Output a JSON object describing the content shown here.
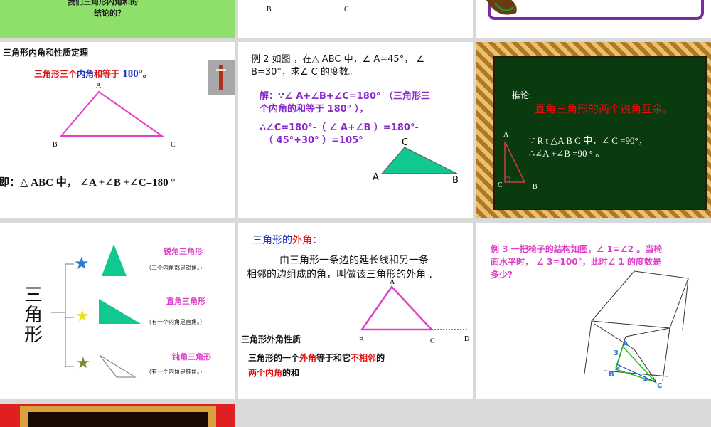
{
  "colors": {
    "gray_bg": "#d9d9d9",
    "green_slide": "#8fe06a",
    "magenta": "#e040c8",
    "red": "#e01010",
    "blue": "#2030c0",
    "purple": "#8a28d0",
    "teal": "#10c890",
    "blackboard": "#0a3a10",
    "frame_gold": "#d9a040"
  },
  "slides": {
    "s1": {
      "lines": [
        "我们三角形内角和的",
        "结论的？"
      ]
    },
    "s2": {
      "labels": {
        "b": "B",
        "c": "C"
      }
    },
    "s4": {
      "title": "三角形内角和性质定理",
      "theorem_red": "三角形三个",
      "theorem_blue": "内角",
      "theorem_red2": "和等于",
      "theorem_value": "180°",
      "theorem_end": "。",
      "labels": {
        "a": "A",
        "b": "B",
        "c": "C"
      },
      "statement": "即：△ ABC 中， ∠A +∠B +∠C=180 °",
      "thumb_icon": "book-image-icon"
    },
    "s5": {
      "problem_1": "例 2  如图 ，在△ ABC 中，∠ A=45°，  ∠",
      "problem_2": "B=30°，求∠ C 的度数。",
      "sol_1": "解：∵∠ A+∠B+∠C=180° （三角形三",
      "sol_2": "个内角的和等于 180° ），",
      "sol_3": "∴∠C=180°-（  ∠ A+∠B ）=180°-",
      "sol_4": "（ 45°+30° ）=105°",
      "labels": {
        "a": "A",
        "b": "B",
        "c": "C"
      }
    },
    "s6": {
      "heading": "推论:",
      "corollary": "直角三角形的两个锐角互余。",
      "given": "∵ R t △A B C  中，∠ C =90°，",
      "result": "∴∠A +∠B =90 ° 。",
      "labels": {
        "a": "A",
        "b": "B",
        "c": "C"
      }
    },
    "s7": {
      "root_label": "三角形",
      "acute_label": "锐角三角形",
      "acute_desc": "（三个内角都是锐角。）",
      "right_label": "直角三角形",
      "right_desc": "（有一个内角是直角。）",
      "obtuse_label": "钝角三角形",
      "obtuse_desc": "（有一个内角是钝角。）",
      "star_icon": "star-icon"
    },
    "s8": {
      "title_prefix": "三角形的",
      "title_key": "外角",
      "title_suffix": "：",
      "def_1": "由三角形一条边的延长线和另一条",
      "def_2": "相邻的边组成的角，叫做该三角形的外角 .",
      "labels": {
        "a": "A",
        "b": "B",
        "c": "C",
        "d": "D"
      },
      "prop_title": "三角形外角性质",
      "prop_1a": "三角形的一个",
      "prop_1b": "外角",
      "prop_1c": "等于和它",
      "prop_1d": "不相邻",
      "prop_1e": "的",
      "prop_2a": "两个内角",
      "prop_2b": "的和"
    },
    "s9": {
      "problem_1": "例 3  一把椅子的结构如图，∠ 1=∠2 。当椅",
      "problem_2": "面水平时，  ∠ 3=100°，此时∠ 1 的度数是",
      "problem_3": "多少?",
      "labels": {
        "a": "A",
        "b": "B",
        "c": "C",
        "n1": "1",
        "n2": "2",
        "n3": "3"
      }
    }
  }
}
